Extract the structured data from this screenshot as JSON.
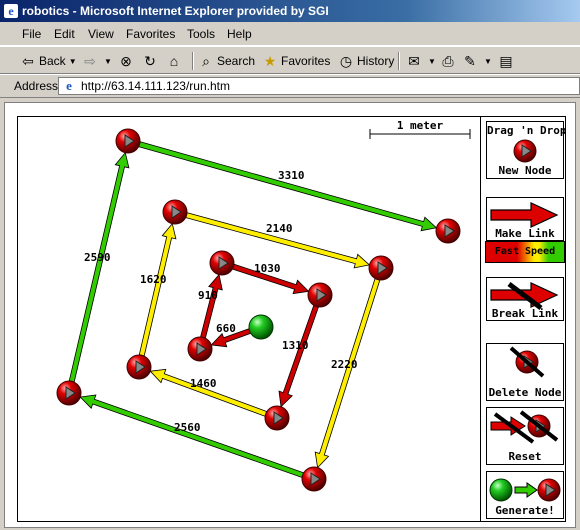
{
  "window": {
    "title": "robotics - Microsoft Internet Explorer provided by SGI"
  },
  "menu": [
    "File",
    "Edit",
    "View",
    "Favorites",
    "Tools",
    "Help"
  ],
  "toolbar": {
    "back": "Back",
    "search": "Search",
    "favorites": "Favorites",
    "history": "History"
  },
  "address": {
    "label": "Address",
    "url": "http://63.14.111.123/run.htm"
  },
  "applet": {
    "scale_label": "1 meter",
    "tools": {
      "new_node": [
        "Drag 'n Drop",
        "New Node"
      ],
      "make_link": "Make Link",
      "speed": "Fast Speed",
      "break_link": "Break Link",
      "delete_node": "Delete Node",
      "reset": "Reset",
      "generate": "Generate!"
    },
    "colors": {
      "node": "#cc0000",
      "node_start": "#22bb22",
      "link_green": "#33cc00",
      "link_yellow": "#ffee00",
      "link_red": "#cc0000"
    },
    "links": [
      {
        "id": "a",
        "label": "3310",
        "color": "green"
      },
      {
        "id": "b",
        "label": "2590",
        "color": "green"
      },
      {
        "id": "c",
        "label": "2560",
        "color": "green"
      },
      {
        "id": "d",
        "label": "2140",
        "color": "yellow"
      },
      {
        "id": "e",
        "label": "1620",
        "color": "yellow"
      },
      {
        "id": "f",
        "label": "2220",
        "color": "yellow"
      },
      {
        "id": "g",
        "label": "1460",
        "color": "yellow"
      },
      {
        "id": "h",
        "label": "1030",
        "color": "red"
      },
      {
        "id": "i",
        "label": "910",
        "color": "red"
      },
      {
        "id": "j",
        "label": "1310",
        "color": "red"
      },
      {
        "id": "k",
        "label": "660",
        "color": "red"
      }
    ]
  }
}
